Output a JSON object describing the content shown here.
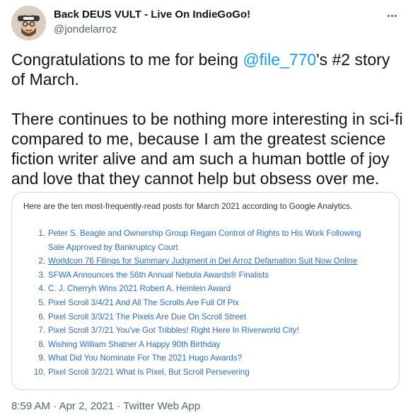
{
  "tweet": {
    "author": {
      "display_name": "Back DEUS VULT - Live On IndieGoGo!",
      "handle": "@jondelarroz",
      "avatar_icon": "user-avatar-icon"
    },
    "more_icon": "more-horizontal-icon",
    "text": {
      "line1_before": "Congratulations to me for being ",
      "mention": "@file_770",
      "line1_after": "'s #2 story of March.",
      "paragraph2": "There continues to be nothing more interesting in sci-fi compared to me, because I am the greatest science fiction writer alive and am such a human bottle of joy and love that they cannot help but obsess over me."
    },
    "media": {
      "intro": "Here are the ten most-frequently-read posts for March 2021 according to Google Analytics.",
      "items": [
        {
          "num": "1.",
          "title": "Peter S. Beagle and Ownership Group Regain Control of Rights to His Work Following Sale Approved by Bankruptcy Court"
        },
        {
          "num": "2.",
          "title": "Worldcon 76 Filings for Summary Judgment in Del Arroz Defamation Suit Now Online"
        },
        {
          "num": "3.",
          "title": "SFWA Announces the 56th Annual Nebula Awards® Finalists"
        },
        {
          "num": "4.",
          "title": "C. J. Cherryh Wins 2021 Robert A. Heinlein Award"
        },
        {
          "num": "5.",
          "title": "Pixel Scroll 3/4/21 And All The Scrolls Are Full Of Pix"
        },
        {
          "num": "6.",
          "title": "Pixel Scroll 3/3/21 The Pixels Are Due On Scroll Street"
        },
        {
          "num": "7.",
          "title": "Pixel Scroll 3/7/21 You've Got Tribbles! Right Here In Riverworld City!"
        },
        {
          "num": "8.",
          "title": "Wishing William Shatner A Happy 90th Birthday"
        },
        {
          "num": "9.",
          "title": "What Did You Nominate For The 2021 Hugo Awards?"
        },
        {
          "num": "10.",
          "title": "Pixel Scroll 3/2/21 What Is Pixel, But Scroll Persevering"
        }
      ],
      "link_color": "#2c6cc9"
    },
    "meta": {
      "time": "8:59 AM",
      "separator": " · ",
      "date": "Apr 2, 2021",
      "source": "Twitter Web App"
    }
  },
  "colors": {
    "text": "#0f1419",
    "secondary": "#536471",
    "accent": "#1d9bf0",
    "border": "#cfd9de"
  }
}
